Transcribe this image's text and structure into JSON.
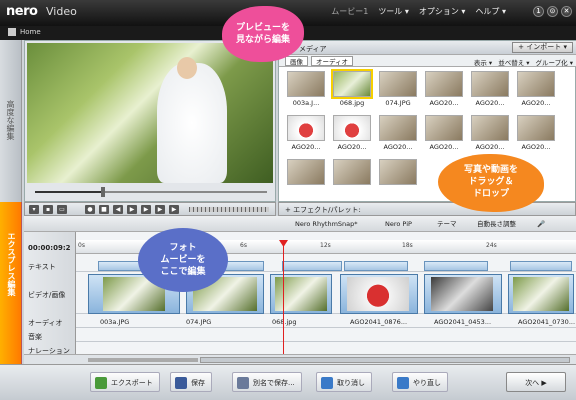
{
  "app": {
    "logo": "nero",
    "name": "Video",
    "breadcrumb": "Home"
  },
  "menu": {
    "items": [
      "ツール ▾",
      "オプション ▾",
      "ヘルプ ▾"
    ],
    "window_hint": "ムービー1"
  },
  "window_buttons": [
    "1",
    "⊙",
    "✕"
  ],
  "left_tabs": {
    "top": "高度な編集",
    "bottom": "エクスプレス編集"
  },
  "media": {
    "title": "メディア",
    "import_label": "+ インポート ▾",
    "tabs": [
      "画像",
      "オーディオ"
    ],
    "tools": [
      "表示 ▾",
      "並べ替え ▾",
      "グループ化 ▾"
    ],
    "thumbnails": [
      {
        "label": "003a.J...",
        "kind": "photo"
      },
      {
        "label": "068.jpg",
        "kind": "green"
      },
      {
        "label": "074.JPG",
        "kind": "photo"
      },
      {
        "label": "AGO20...",
        "kind": "photo"
      },
      {
        "label": "AGO20...",
        "kind": "photo"
      },
      {
        "label": "AGO20...",
        "kind": "photo"
      },
      {
        "label": "AGO20...",
        "kind": "red"
      },
      {
        "label": "AGO20...",
        "kind": "red"
      },
      {
        "label": "AGO20...",
        "kind": "photo"
      },
      {
        "label": "AGO20...",
        "kind": "photo"
      },
      {
        "label": "AGO20...",
        "kind": "photo"
      },
      {
        "label": "AGO20...",
        "kind": "photo"
      },
      {
        "label": "",
        "kind": "photo"
      },
      {
        "label": "",
        "kind": "photo"
      },
      {
        "label": "",
        "kind": "photo"
      }
    ]
  },
  "effects": {
    "label": "+ エフェクト/パレット:"
  },
  "row2": {
    "items": [
      "Nero RhythmSnap*",
      "Nero PiP",
      "テーマ",
      "自動長さ調整"
    ]
  },
  "timeline": {
    "timecode": "00:00:09:2",
    "ticks": [
      "0s",
      "6s",
      "12s",
      "18s",
      "24s"
    ],
    "tracks": [
      "テキスト",
      "ビデオ/画像",
      "オーディオ",
      "音楽",
      "ナレーション"
    ],
    "clip_names": [
      "003a.JPG",
      "074.JPG",
      "068.jpg",
      "AGO2041_0876...",
      "AGO2041_0453...",
      "AGO2041_0730..."
    ]
  },
  "bottom": {
    "buttons": [
      "エクスポート",
      "保存",
      "別名で保存...",
      "取り消し",
      "やり直し"
    ],
    "next": "次へ ▶"
  },
  "callouts": {
    "preview": [
      "プレビューを",
      "見ながら編集"
    ],
    "drag": [
      "写真や動画を",
      "ドラッグ＆",
      "ドロップ"
    ],
    "photo": [
      "フォト",
      "ムービーを",
      "ここで編集"
    ]
  },
  "colors": {
    "accent_orange": "#ff8c00",
    "callout_pink": "#ee4f9a",
    "callout_orange": "#f5881f",
    "callout_blue": "#5a6fc8",
    "playhead": "#e02020"
  }
}
